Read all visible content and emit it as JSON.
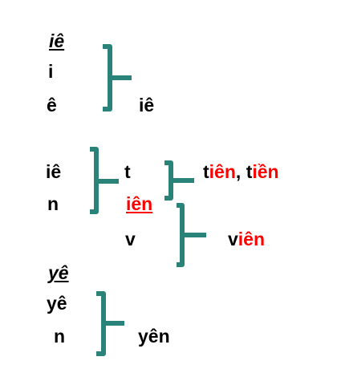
{
  "colors": {
    "text": "#000000",
    "highlight": "#ff0000",
    "bracket": "#2a8378"
  },
  "section_ie": {
    "heading": "iê",
    "letter_1": "i",
    "letter_2": "ê",
    "result": "iê"
  },
  "section_ien": {
    "part_1": "iê",
    "part_2": "n",
    "combined": "iên",
    "consonant_1": "t",
    "consonant_2": "v",
    "word_tien_prefix": "t",
    "word_tien_vowel": "iên",
    "separator": ", ",
    "word_tien2_prefix": "t",
    "word_tien2_vowel": "iền",
    "word_vien_prefix": "v",
    "word_vien_vowel": "iên"
  },
  "section_ye": {
    "heading": "yê",
    "part_1": "yê",
    "part_2": "n",
    "result": "yên"
  }
}
